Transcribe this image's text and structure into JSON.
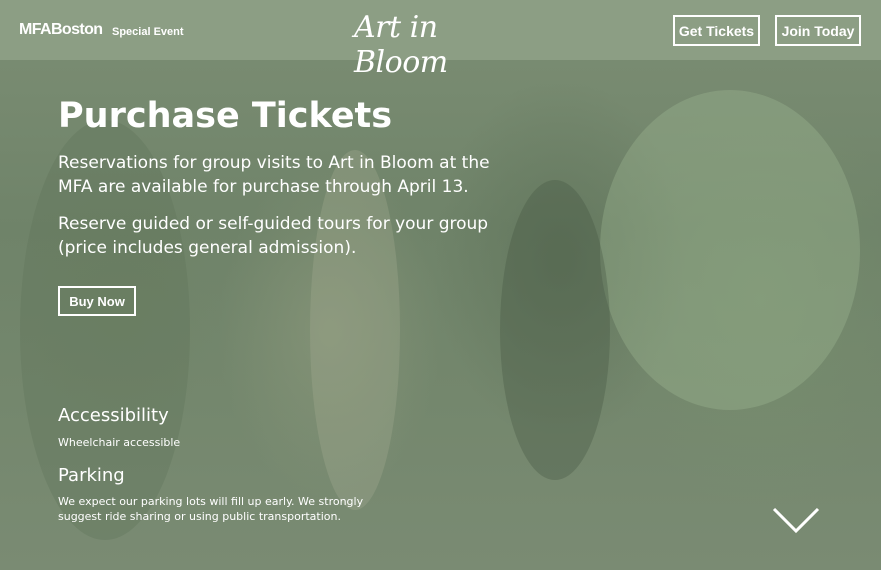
{
  "header": {
    "logo": "MFABoston",
    "event_tag": "Special Event",
    "brand": "Art in Bloom",
    "get_tickets": "Get Tickets",
    "join_today": "Join Today"
  },
  "hero": {
    "title": "Purchase Tickets",
    "paragraph1": "Reservations for group visits to Art in Bloom at the MFA are available for purchase through April 13.",
    "paragraph2": "Reserve guided or self-guided tours for your group (price includes general admission).",
    "buy_now": "Buy Now"
  },
  "info": {
    "accessibility_heading": "Accessibility",
    "accessibility_text": "Wheelchair accessible",
    "parking_heading": "Parking",
    "parking_text": "We expect our parking lots will fill up early. We strongly suggest ride sharing or using public transportation."
  },
  "icons": {
    "scroll": "chevron-down-icon"
  },
  "colors": {
    "header_bg": "#8ea086",
    "overlay": "#74876d",
    "text": "#ffffff"
  }
}
